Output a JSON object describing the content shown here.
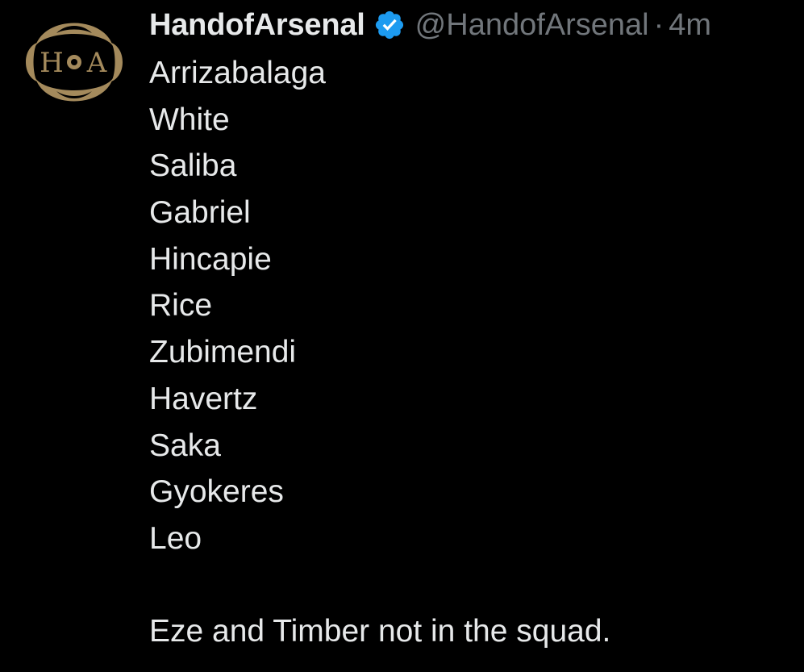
{
  "author": {
    "display_name": "HandofArsenal",
    "handle": "@HandofArsenal",
    "separator": "·",
    "time": "4m",
    "verified": true,
    "avatar": {
      "initials_left": "H",
      "initials_right": "A",
      "color": "#a48a5c"
    },
    "verified_color": "#1d9bf0"
  },
  "tweet": {
    "lineup": [
      "Arrizabalaga",
      "White",
      "Saliba",
      "Gabriel",
      "Hincapie",
      "Rice",
      "Zubimendi",
      "Havertz",
      "Saka",
      "Gyokeres",
      "Leo"
    ],
    "note": "Eze and Timber not in the squad."
  },
  "colors": {
    "background": "#000000",
    "text": "#e7e9ea",
    "muted": "#71767b"
  }
}
